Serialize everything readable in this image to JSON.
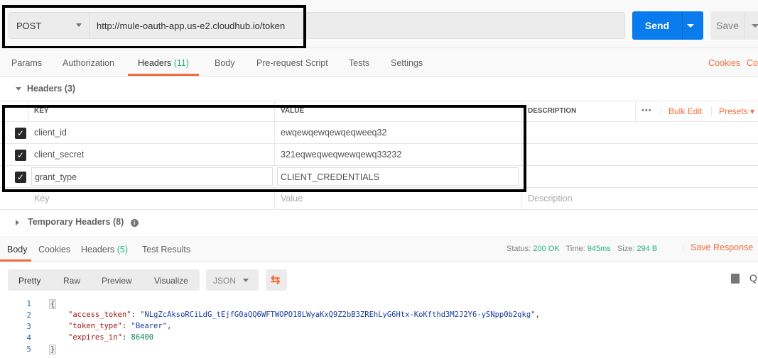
{
  "request": {
    "method": "POST",
    "url": "http://mule-oauth-app.us-e2.cloudhub.io/token",
    "send_label": "Send",
    "save_label": "Save"
  },
  "tabs": [
    {
      "label": "Params"
    },
    {
      "label": "Authorization"
    },
    {
      "label": "Headers",
      "count": "(11)"
    },
    {
      "label": "Body"
    },
    {
      "label": "Pre-request Script"
    },
    {
      "label": "Tests"
    },
    {
      "label": "Settings"
    }
  ],
  "links": {
    "cookies": "Cookies",
    "code": "Code"
  },
  "headers_section": {
    "title": "Headers (3)",
    "columns": {
      "key": "KEY",
      "value": "VALUE",
      "description": "DESCRIPTION"
    },
    "more": "•••",
    "bulk_edit": "Bulk Edit",
    "presets": "Presets",
    "rows": [
      {
        "key": "client_id",
        "value": "ewqewqewqewqeqweeq32",
        "checked": true
      },
      {
        "key": "client_secret",
        "value": "321eqweqweqwewqewq33232",
        "checked": true
      },
      {
        "key": "grant_type",
        "value": "CLIENT_CREDENTIALS",
        "checked": true
      }
    ],
    "placeholders": {
      "key": "Key",
      "value": "Value",
      "description": "Description"
    }
  },
  "temp_headers": "Temporary Headers (8)",
  "response": {
    "tabs": [
      {
        "label": "Body"
      },
      {
        "label": "Cookies"
      },
      {
        "label": "Headers",
        "count": "(5)"
      },
      {
        "label": "Test Results"
      }
    ],
    "status_label": "Status:",
    "status": "200 OK",
    "time_label": "Time:",
    "time": "945ms",
    "size_label": "Size:",
    "size": "294 B",
    "save_response": "Save Response",
    "views": [
      "Pretty",
      "Raw",
      "Preview",
      "Visualize"
    ],
    "format": "JSON",
    "lines": [
      "1",
      "2",
      "3",
      "4",
      "5"
    ],
    "body": {
      "open": "{",
      "k1": "\"access_token\"",
      "v1": "\"NLgZcAksoRCiLdG_tEjfG0aQQ6WFTWOPO18LWyaKxQ9Z2bB3ZREhLyG6Htx-KoKfthd3M2J2Y6-ySNpp0b2qkg\"",
      "k2": "\"token_type\"",
      "v2": "\"Bearer\"",
      "k3": "\"expires_in\"",
      "v3": "86400",
      "close": "}"
    }
  }
}
